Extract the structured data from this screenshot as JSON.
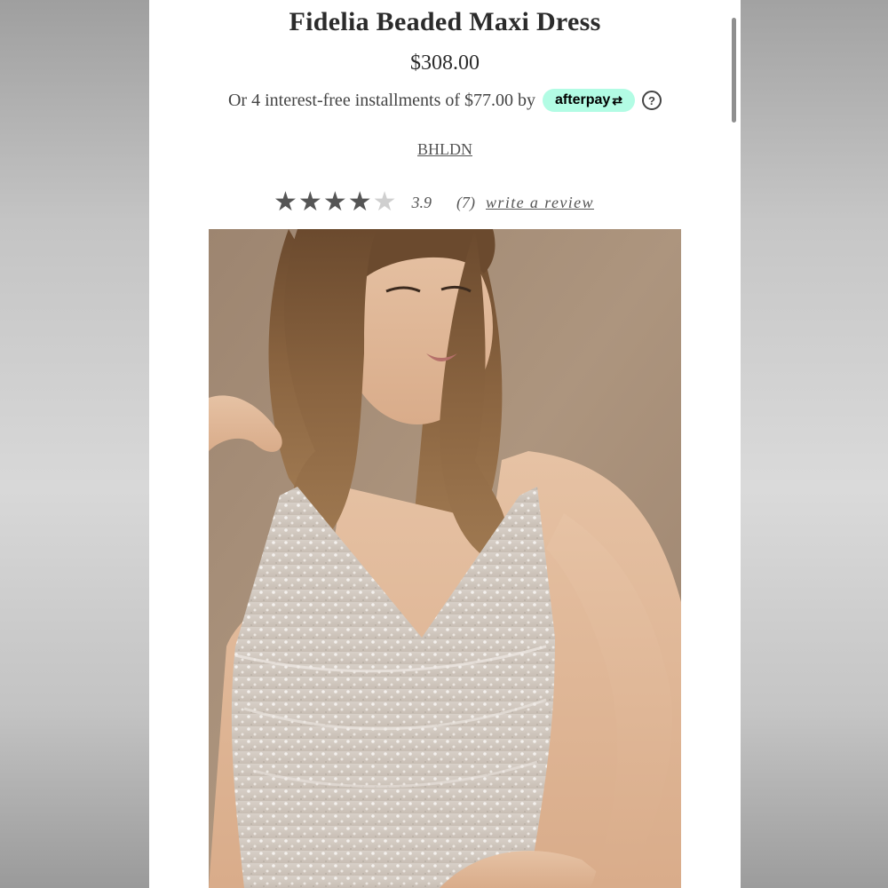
{
  "product": {
    "title": "Fidelia Beaded Maxi Dress",
    "price": "$308.00",
    "installments_text": "Or 4 interest-free installments of $77.00 by",
    "afterpay_label": "afterpay",
    "afterpay_icon": "afterpay-arrows-icon",
    "help_icon_label": "?",
    "brand": "BHLDN",
    "rating": {
      "stars_filled": 4,
      "stars_total": 5,
      "value": "3.9",
      "count": "(7)",
      "write_review": "write a review"
    },
    "image_alt": "model wearing beaded dress"
  },
  "colors": {
    "afterpay_mint": "#b2fce4",
    "star_filled": "#555555",
    "star_empty": "#cfcfcf",
    "background_beige": "#a88f78"
  }
}
